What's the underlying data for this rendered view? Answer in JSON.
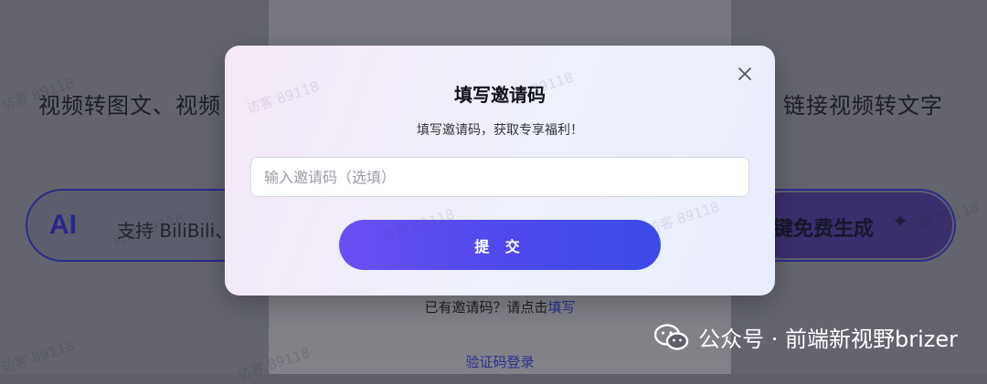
{
  "background": {
    "title_left": "视频转图文、视频",
    "title_right": "链接视频转文字",
    "ai_label": "AI",
    "input_placeholder": "支持 BiliBili、",
    "generate_button": "键免费生成",
    "sparkle_icon": "sparkle-icon",
    "have_code_prefix": "已有邀请码？请点击",
    "have_code_link": "填写",
    "login_link": "验证码登录",
    "watermark_text": "访客 89118"
  },
  "modal": {
    "title": "填写邀请码",
    "subtitle": "填写邀请码，获取专享福利！",
    "input_placeholder": "输入邀请码（选填）",
    "submit_label": "提 交",
    "close_icon": "close-icon",
    "accent_color": "#5048ec"
  },
  "brand_watermark": {
    "text": "公众号 · 前端新视野brizer",
    "icon": "wechat-icon"
  }
}
